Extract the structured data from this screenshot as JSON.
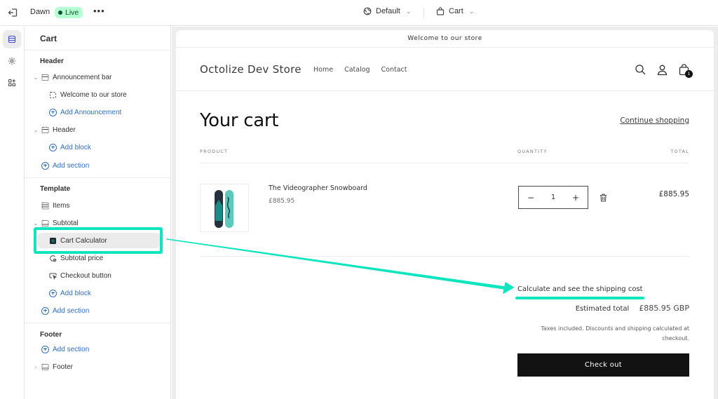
{
  "topbar": {
    "theme_name": "Dawn",
    "status_badge": "Live",
    "more_label": "•••",
    "context_selector": "Default",
    "template_selector": "Cart"
  },
  "rail": {
    "items": [
      {
        "icon": "sections-icon",
        "active": true
      },
      {
        "icon": "settings-gear-icon",
        "active": false
      },
      {
        "icon": "apps-icon",
        "active": false
      }
    ]
  },
  "sidebar": {
    "title": "Cart",
    "groups": {
      "header": {
        "label": "Header",
        "announcement_bar": "Announcement bar",
        "welcome_block": "Welcome to our store",
        "add_announcement": "Add Announcement",
        "header_section": "Header",
        "add_block": "Add block",
        "add_section": "Add section"
      },
      "template": {
        "label": "Template",
        "items": "Items",
        "subtotal": "Subtotal",
        "cart_calculator": "Cart Calculator",
        "subtotal_price": "Subtotal price",
        "checkout_button": "Checkout button",
        "add_block": "Add block",
        "add_section": "Add section"
      },
      "footer": {
        "label": "Footer",
        "add_section": "Add section",
        "footer_section": "Footer"
      }
    }
  },
  "preview": {
    "announcement": "Welcome to our store",
    "store_name": "Octolize Dev Store",
    "nav": [
      "Home",
      "Catalog",
      "Contact"
    ],
    "cart_count": "1",
    "page_title": "Your cart",
    "continue_shopping": "Continue shopping",
    "columns": {
      "product": "PRODUCT",
      "quantity": "QUANTITY",
      "total": "TOTAL"
    },
    "line_item": {
      "name": "The Videographer Snowboard",
      "price": "£885.95",
      "quantity": "1",
      "total": "£885.95"
    },
    "calculate_shipping": "Calculate and see the shipping cost",
    "estimated_total_label": "Estimated total",
    "estimated_total_value": "£885.95 GBP",
    "taxes_note": "Taxes included. Discounts and shipping calculated at checkout.",
    "checkout_button": "Check out"
  },
  "annotation": {
    "color": "#0fe5bf"
  }
}
